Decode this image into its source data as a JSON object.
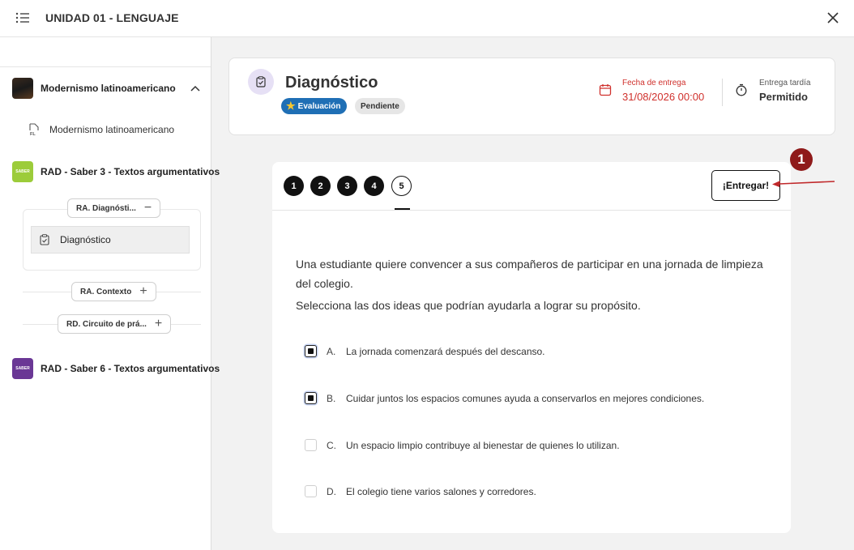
{
  "topbar": {
    "title": "UNIDAD 01 - LENGUAJE"
  },
  "sidebar": {
    "course1": {
      "name": "Modernismo latinoamericano",
      "sub_item": "Modernismo latinoamericano"
    },
    "course2": {
      "name": "RAD - Saber 3 - Textos argumentativos",
      "section_diag": "RA. Diagnósti...",
      "activity": "Diagnóstico",
      "section_contexto": "RA. Contexto",
      "section_circuito": "RD. Circuito de prá..."
    },
    "course3": {
      "name": "RAD - Saber 6 - Textos argumentativos"
    },
    "thumb_label": "SABER"
  },
  "header": {
    "title": "Diagnóstico",
    "badge_eval": "Evaluación",
    "badge_status": "Pendiente",
    "due_label": "Fecha de entrega",
    "due_value": "31/08/2026 00:00",
    "late_label": "Entrega tardía",
    "late_value": "Permitido"
  },
  "question": {
    "tabs": [
      "1",
      "2",
      "3",
      "4",
      "5"
    ],
    "active_tab": "5",
    "submit_label": "¡Entregar!",
    "text_line1": "Una estudiante quiere convencer a sus compañeros de participar en una jornada de limpieza del colegio.",
    "text_line2": "Selecciona las dos ideas que podrían ayudarla a lograr su propósito.",
    "options": [
      {
        "letter": "A.",
        "text": "La jornada comenzará después del descanso.",
        "checked": true
      },
      {
        "letter": "B.",
        "text": "Cuidar juntos los espacios comunes ayuda a conservarlos en mejores condiciones.",
        "checked": true
      },
      {
        "letter": "C.",
        "text": "Un espacio limpio contribuye al bienestar de quienes lo utilizan.",
        "checked": false
      },
      {
        "letter": "D.",
        "text": "El colegio tiene varios salones y corredores.",
        "checked": false
      }
    ]
  },
  "annotation": {
    "number": "1"
  },
  "colors": {
    "accent_red": "#d0312d",
    "badge_blue": "#1f6fb5",
    "annotation": "#8f1a1a"
  }
}
